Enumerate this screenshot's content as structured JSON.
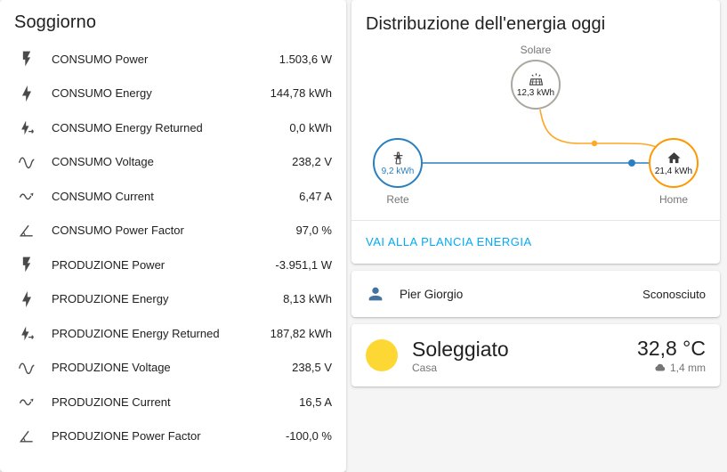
{
  "colors": {
    "link_accent": "#03a9f4",
    "grid_blue": "#2a7fbf",
    "solar_orange": "#ff9800",
    "sun_yellow": "#fdd835",
    "card_background": "#ffffff",
    "page_background": "#f5f5f5"
  },
  "sensors": {
    "title": "Soggiorno",
    "rows": [
      {
        "icon": "flash-icon",
        "label": "CONSUMO Power",
        "value": "1.503,6 W"
      },
      {
        "icon": "lightning-bolt-icon",
        "label": "CONSUMO Energy",
        "value": "144,78 kWh"
      },
      {
        "icon": "lightning-return-icon",
        "label": "CONSUMO Energy Returned",
        "value": "0,0 kWh"
      },
      {
        "icon": "sine-wave-icon",
        "label": "CONSUMO Voltage",
        "value": "238,2 V"
      },
      {
        "icon": "current-ac-icon",
        "label": "CONSUMO Current",
        "value": "6,47 A"
      },
      {
        "icon": "angle-acute-icon",
        "label": "CONSUMO Power Factor",
        "value": "97,0 %"
      },
      {
        "icon": "flash-icon",
        "label": "PRODUZIONE Power",
        "value": "-3.951,1 W"
      },
      {
        "icon": "lightning-bolt-icon",
        "label": "PRODUZIONE Energy",
        "value": "8,13 kWh"
      },
      {
        "icon": "lightning-return-icon",
        "label": "PRODUZIONE Energy Returned",
        "value": "187,82 kWh"
      },
      {
        "icon": "sine-wave-icon",
        "label": "PRODUZIONE Voltage",
        "value": "238,5 V"
      },
      {
        "icon": "current-ac-icon",
        "label": "PRODUZIONE Current",
        "value": "16,5 A"
      },
      {
        "icon": "angle-acute-icon",
        "label": "PRODUZIONE Power Factor",
        "value": "-100,0 %"
      }
    ]
  },
  "energy": {
    "title": "Distribuzione dell'energia oggi",
    "solar": {
      "label": "Solare",
      "value": "12,3 kWh",
      "icon": "solar-power-icon"
    },
    "grid": {
      "label": "Rete",
      "value": "9,2 kWh",
      "icon": "transmission-tower-icon"
    },
    "home": {
      "label": "Home",
      "value": "21,4 kWh",
      "icon": "home-icon"
    },
    "link_label": "VAI ALLA PLANCIA ENERGIA"
  },
  "person": {
    "name": "Pier Giorgio",
    "status": "Sconosciuto",
    "icon": "account-icon"
  },
  "weather": {
    "condition": "Soleggiato",
    "location": "Casa",
    "temperature": "32,8 °C",
    "precipitation": "1,4 mm",
    "condition_icon": "sunny-icon",
    "precipitation_icon": "rain-cloud-icon"
  }
}
